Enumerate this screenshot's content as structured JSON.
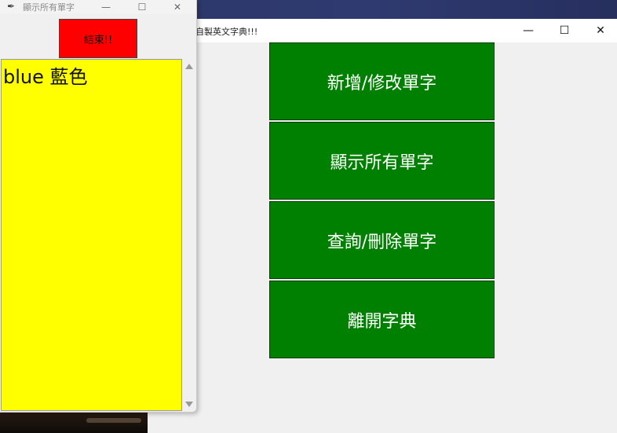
{
  "main_window": {
    "title": "的自製英文字典!!!",
    "controls": {
      "minimize": "—",
      "maximize": "☐",
      "close": "✕"
    },
    "buttons": [
      {
        "label": "新增/修改單字"
      },
      {
        "label": "顯示所有單字"
      },
      {
        "label": "查詢/刪除單字"
      },
      {
        "label": "離開字典"
      }
    ]
  },
  "list_window": {
    "title": "顯示所有單字",
    "controls": {
      "minimize": "—",
      "maximize": "☐",
      "close": "✕"
    },
    "end_button": "結束!!",
    "words": [
      "blue 藍色"
    ]
  },
  "colors": {
    "button_green": "#008000",
    "end_red": "#ff0000",
    "list_yellow": "#ffff00"
  },
  "icons": {
    "app_icon": "feather-icon"
  }
}
